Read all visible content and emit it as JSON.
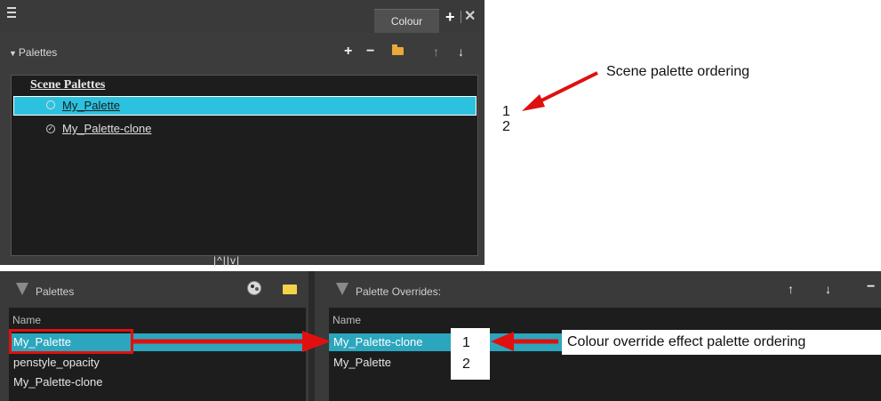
{
  "top_panel": {
    "tab_label": "Colour",
    "section_title": "Palettes",
    "toolbar_icons": [
      "add-icon",
      "remove-icon",
      "folder-icon",
      "move-up-icon",
      "move-down-icon"
    ],
    "list_title": "Scene Palettes",
    "rows": [
      {
        "label": "My_Palette",
        "selected": true
      },
      {
        "label": "My_Palette-clone",
        "selected": false
      }
    ],
    "bottom_arrows": "|^||v|"
  },
  "annotations": {
    "scene_ordering": "Scene palette ordering",
    "scene_numbers": [
      "1",
      "2"
    ],
    "override_ordering": "Colour override effect palette ordering",
    "override_numbers": [
      "1",
      "2"
    ]
  },
  "bottom_left": {
    "title": "Palettes",
    "column_header": "Name",
    "rows": [
      "My_Palette",
      "penstyle_opacity",
      "My_Palette-clone"
    ]
  },
  "bottom_right": {
    "title": "Palette Overrides:",
    "column_header": "Name",
    "rows": [
      "My_Palette-clone",
      "My_Palette"
    ]
  },
  "colors": {
    "selection": "#2cc2df",
    "arrow": "#e01010",
    "panel_bg": "#3c3c3c",
    "list_bg": "#1d1d1d"
  }
}
